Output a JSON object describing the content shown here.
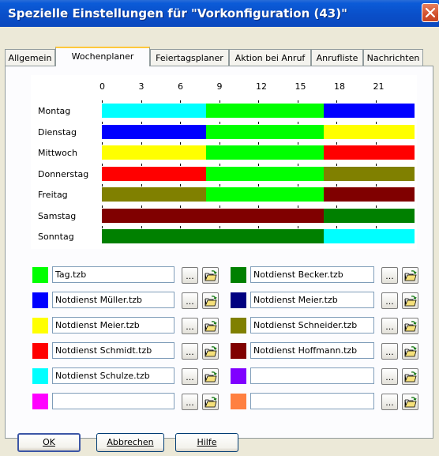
{
  "window": {
    "title": "Spezielle Einstellungen für \"Vorkonfiguration (43)\""
  },
  "tabs": [
    {
      "label": "Allgemein",
      "active": false
    },
    {
      "label": "Wochenplaner",
      "active": true
    },
    {
      "label": "Feiertagsplaner",
      "active": false
    },
    {
      "label": "Aktion bei Anruf",
      "active": false
    },
    {
      "label": "Anrufliste",
      "active": false
    },
    {
      "label": "Nachrichten",
      "active": false
    }
  ],
  "schedule": {
    "hours": [
      "0",
      "3",
      "6",
      "9",
      "12",
      "15",
      "18",
      "21"
    ],
    "days": [
      {
        "label": "Montag",
        "segments": [
          {
            "from": 0,
            "to": 8,
            "color": "#00FFFF"
          },
          {
            "from": 8,
            "to": 17,
            "color": "#00FF00"
          },
          {
            "from": 17,
            "to": 24,
            "color": "#0000FF"
          }
        ]
      },
      {
        "label": "Dienstag",
        "segments": [
          {
            "from": 0,
            "to": 8,
            "color": "#0000FF"
          },
          {
            "from": 8,
            "to": 17,
            "color": "#00FF00"
          },
          {
            "from": 17,
            "to": 24,
            "color": "#FFFF00"
          }
        ]
      },
      {
        "label": "Mittwoch",
        "segments": [
          {
            "from": 0,
            "to": 8,
            "color": "#FFFF00"
          },
          {
            "from": 8,
            "to": 17,
            "color": "#00FF00"
          },
          {
            "from": 17,
            "to": 24,
            "color": "#FF0000"
          }
        ]
      },
      {
        "label": "Donnerstag",
        "segments": [
          {
            "from": 0,
            "to": 8,
            "color": "#FF0000"
          },
          {
            "from": 8,
            "to": 17,
            "color": "#00FF00"
          },
          {
            "from": 17,
            "to": 24,
            "color": "#808000"
          }
        ]
      },
      {
        "label": "Freitag",
        "segments": [
          {
            "from": 0,
            "to": 8,
            "color": "#808000"
          },
          {
            "from": 8,
            "to": 17,
            "color": "#00FF00"
          },
          {
            "from": 17,
            "to": 24,
            "color": "#800000"
          }
        ]
      },
      {
        "label": "Samstag",
        "segments": [
          {
            "from": 0,
            "to": 17,
            "color": "#800000"
          },
          {
            "from": 17,
            "to": 24,
            "color": "#008000"
          }
        ]
      },
      {
        "label": "Sonntag",
        "segments": [
          {
            "from": 0,
            "to": 17,
            "color": "#008000"
          },
          {
            "from": 17,
            "to": 24,
            "color": "#00FFFF"
          }
        ]
      }
    ]
  },
  "assignments": {
    "left": [
      {
        "color": "#00FF00",
        "file": "Tag.tzb"
      },
      {
        "color": "#0000FF",
        "file": "Notdienst Müller.tzb"
      },
      {
        "color": "#FFFF00",
        "file": "Notdienst Meier.tzb"
      },
      {
        "color": "#FF0000",
        "file": "Notdienst Schmidt.tzb"
      },
      {
        "color": "#00FFFF",
        "file": "Notdienst Schulze.tzb"
      },
      {
        "color": "#FF00FF",
        "file": ""
      }
    ],
    "right": [
      {
        "color": "#008000",
        "file": "Notdienst Becker.tzb"
      },
      {
        "color": "#000080",
        "file": "Notdienst Meier.tzb"
      },
      {
        "color": "#808000",
        "file": "Notdienst Schneider.tzb"
      },
      {
        "color": "#800000",
        "file": "Notdienst Hoffmann.tzb"
      },
      {
        "color": "#8000FF",
        "file": ""
      },
      {
        "color": "#FF8040",
        "file": ""
      }
    ],
    "browse_label": "..."
  },
  "buttons": {
    "ok": "OK",
    "cancel": "Abbrechen",
    "help": "Hilfe"
  }
}
